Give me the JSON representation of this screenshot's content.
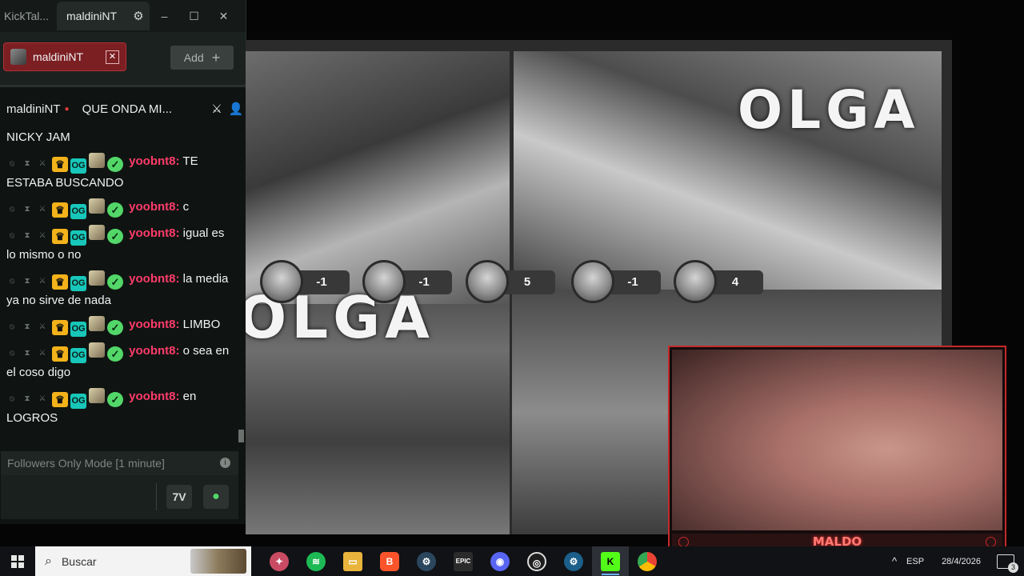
{
  "chat_window": {
    "app_title": "KickTal...",
    "tab_title": "maldiniNT",
    "channel_chip": "maldiniNT",
    "add_label": "Add",
    "channel_name": "maldiniNT",
    "stream_title": "QUE ONDA MI...",
    "messages": [
      {
        "user": "",
        "text": "NICKY JAM"
      },
      {
        "user": "yoobnt8:",
        "text": "TE ESTABA BUSCANDO"
      },
      {
        "user": "yoobnt8:",
        "text": "c"
      },
      {
        "user": "yoobnt8:",
        "text": "igual es lo mismo o no"
      },
      {
        "user": "yoobnt8:",
        "text": "la media ya no sirve de nada"
      },
      {
        "user": "yoobnt8:",
        "text": "LIMBO"
      },
      {
        "user": "yoobnt8:",
        "text": "o sea en el coso digo"
      },
      {
        "user": "yoobnt8:",
        "text": "en LOGROS"
      }
    ],
    "followers_mode": "Followers Only Mode [1 minute]",
    "emote_icon": "7tv-icon",
    "send_icon": "chat-bubble-icon"
  },
  "stream": {
    "logo_text_1": "OLGA",
    "logo_text_2": "OLGA",
    "scores": [
      "-1",
      "-1",
      "5",
      "-1",
      "4"
    ]
  },
  "webcam": {
    "name": "MALDO",
    "accent": "#c42a2a"
  },
  "taskbar": {
    "search_placeholder": "Buscar",
    "apps": [
      "bug-app-icon",
      "spotify-icon",
      "file-explorer-icon",
      "brave-icon",
      "steam-icon",
      "epic-games-icon",
      "discord-icon",
      "obs-icon",
      "steam-icon",
      "kick-icon",
      "chrome-icon"
    ],
    "language": "ESP",
    "date": "28/4/2026",
    "notifications": "3"
  }
}
